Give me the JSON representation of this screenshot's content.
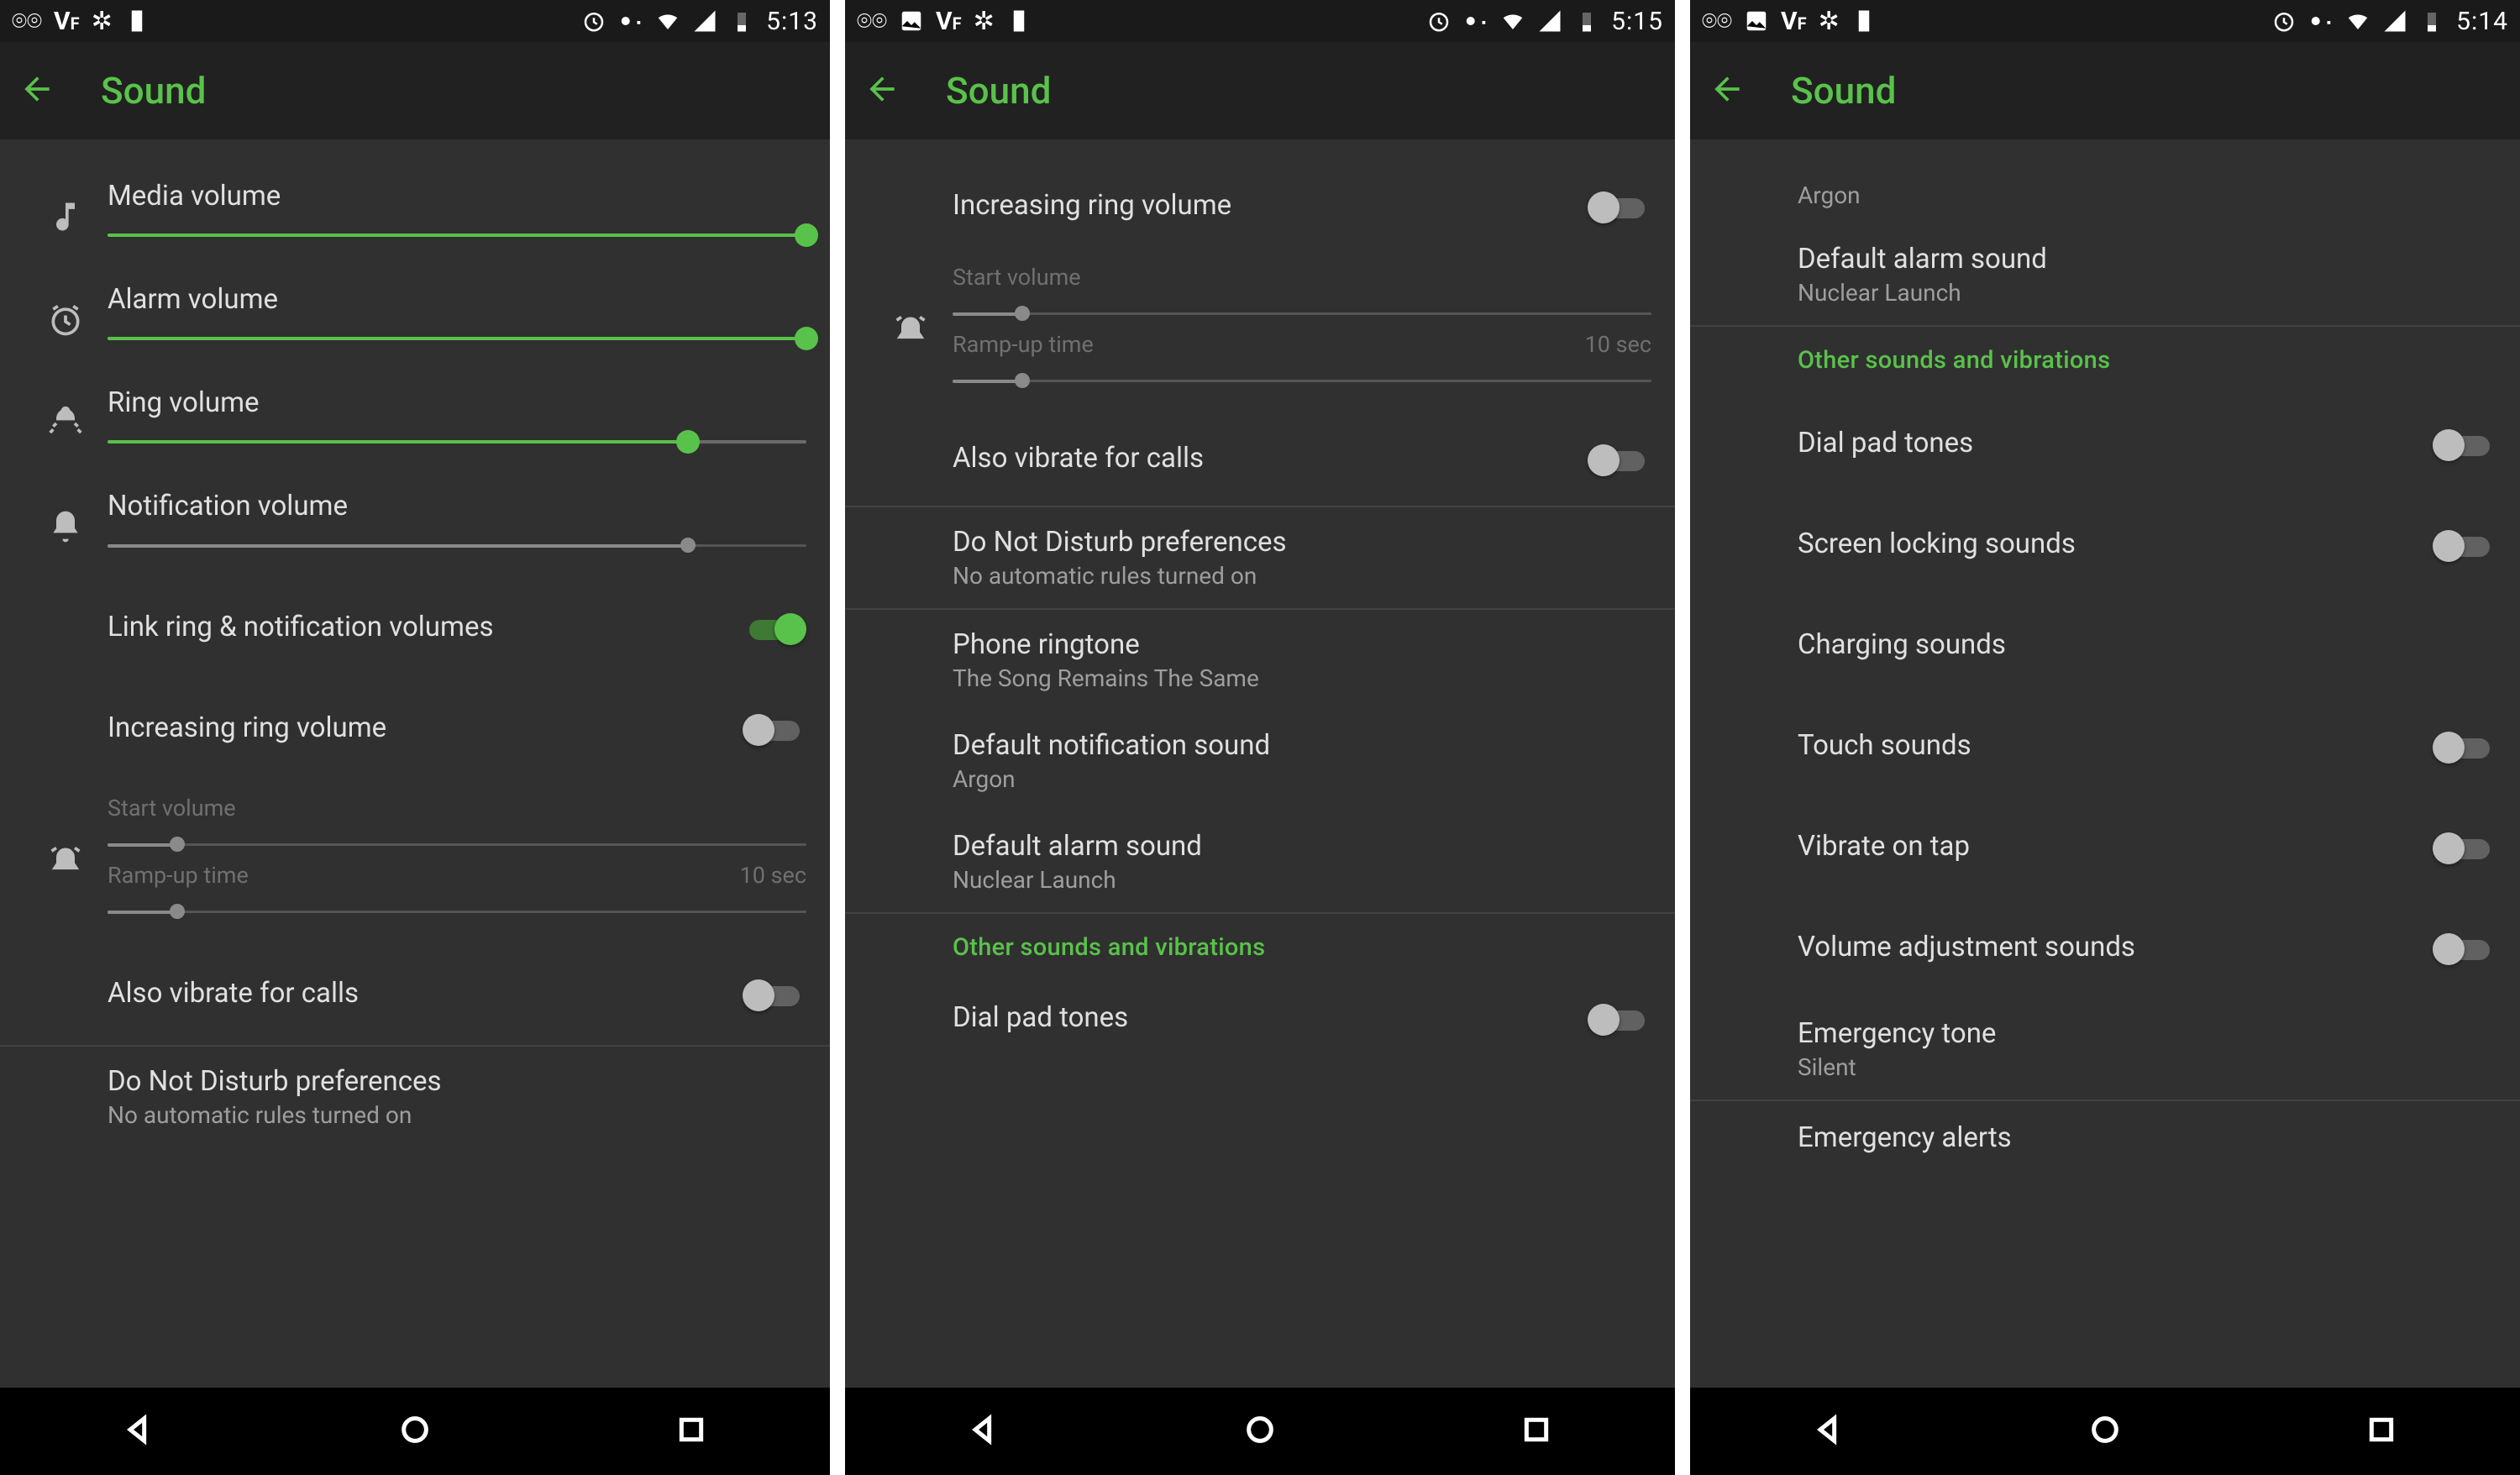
{
  "p1": {
    "status": {
      "time": "5:13"
    },
    "title": "Sound",
    "items": {
      "media": "Media volume",
      "mediaPct": 100,
      "alarm": "Alarm volume",
      "alarmPct": 100,
      "ring": "Ring volume",
      "ringPct": 83,
      "notif": "Notification volume",
      "notifPct": 83,
      "link": "Link ring & notification volumes",
      "linkOn": true,
      "inc": "Increasing ring volume",
      "incOn": false,
      "start": "Start volume",
      "startPct": 10,
      "ramp": "Ramp-up time",
      "rampVal": "10 sec",
      "rampPct": 10,
      "vib": "Also vibrate for calls",
      "vibOn": false,
      "dnd": "Do Not Disturb preferences",
      "dndSub": "No automatic rules turned on"
    }
  },
  "p2": {
    "status": {
      "time": "5:15"
    },
    "title": "Sound",
    "items": {
      "inc": "Increasing ring volume",
      "incOn": false,
      "start": "Start volume",
      "startPct": 10,
      "ramp": "Ramp-up time",
      "rampVal": "10 sec",
      "rampPct": 10,
      "vib": "Also vibrate for calls",
      "vibOn": false,
      "dnd": "Do Not Disturb preferences",
      "dndSub": "No automatic rules turned on",
      "ringtone": "Phone ringtone",
      "ringtoneSub": "The Song Remains The Same",
      "notifSound": "Default notification sound",
      "notifSoundSub": "Argon",
      "alarmSound": "Default alarm sound",
      "alarmSoundSub": "Nuclear Launch",
      "otherHeader": "Other sounds and vibrations",
      "dialpad": "Dial pad tones",
      "dialpadOn": false
    }
  },
  "p3": {
    "status": {
      "time": "5:14"
    },
    "title": "Sound",
    "items": {
      "argon": "Argon",
      "alarmSound": "Default alarm sound",
      "alarmSoundSub": "Nuclear Launch",
      "otherHeader": "Other sounds and vibrations",
      "dialpad": "Dial pad tones",
      "dialpadOn": false,
      "lock": "Screen locking sounds",
      "lockOn": false,
      "charge": "Charging sounds",
      "touch": "Touch sounds",
      "touchOn": false,
      "tapvib": "Vibrate on tap",
      "tapvibOn": false,
      "voladj": "Volume adjustment sounds",
      "voladjOn": false,
      "emTone": "Emergency tone",
      "emToneSub": "Silent",
      "emAlert": "Emergency alerts"
    }
  }
}
